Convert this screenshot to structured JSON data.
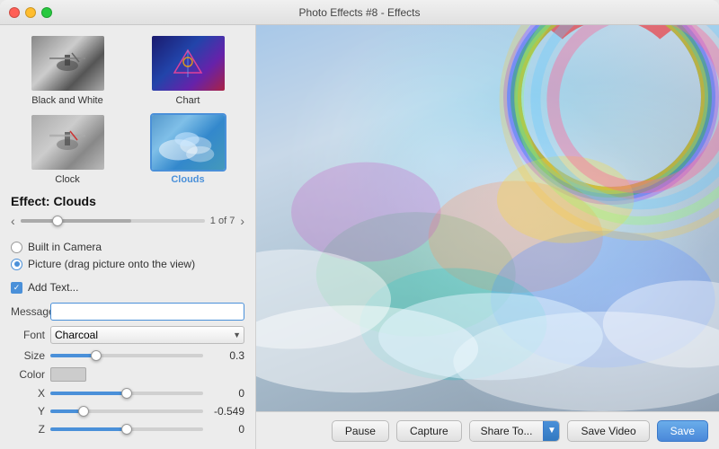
{
  "window": {
    "title": "Photo Effects #8 - Effects"
  },
  "thumbnails": [
    {
      "id": "black-and-white",
      "label": "Black and White",
      "selected": false
    },
    {
      "id": "chart",
      "label": "Chart",
      "selected": false
    },
    {
      "id": "clock",
      "label": "Clock",
      "selected": false
    },
    {
      "id": "clouds",
      "label": "Clouds",
      "selected": true
    }
  ],
  "effect": {
    "name": "Effect:  Clouds",
    "nav_count": "1 of 7"
  },
  "radio": {
    "option1": "Built in Camera",
    "option2": "Picture (drag picture onto the view)"
  },
  "controls": {
    "add_text_label": "Add Text...",
    "message_label": "Message",
    "message_value": "",
    "font_label": "Font",
    "font_value": "Charcoal",
    "size_label": "Size",
    "size_value": "0.3",
    "color_label": "Color",
    "x_label": "X",
    "x_value": "0",
    "y_label": "Y",
    "y_value": "-0.549",
    "z_label": "Z",
    "z_value": "0"
  },
  "buttons": {
    "pause": "Pause",
    "capture": "Capture",
    "share_to": "Share To...",
    "save_video": "Save Video",
    "save": "Save"
  }
}
